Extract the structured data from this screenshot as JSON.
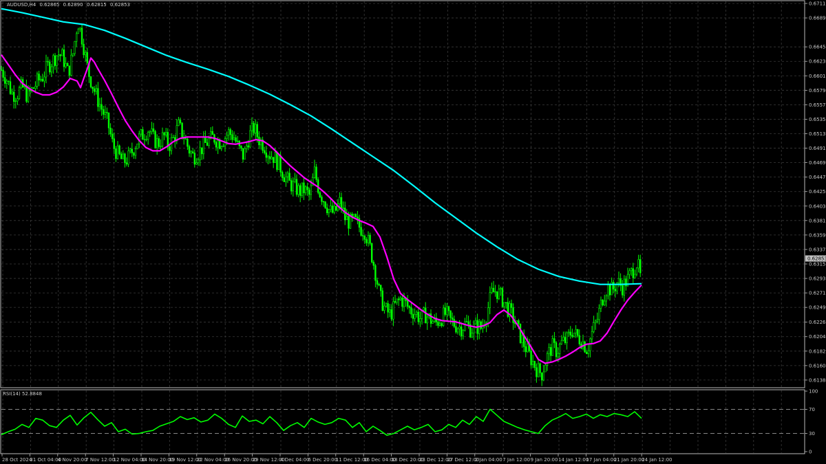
{
  "header": {
    "symbol_label": "AUDUSD,H4",
    "ohlc": [
      "0.62865",
      "0.62890",
      "0.62815",
      "0.62853"
    ]
  },
  "current_price_label": "0.62853",
  "rsi_label": "RSI(14) 52.8848",
  "colors": {
    "background": "#000000",
    "grid": "#3a3a3a",
    "bull_candle": "#00ff00",
    "bear_candle": "#00ff00",
    "ma_fast": "#ff00ff",
    "ma_slow": "#00ffff",
    "rsi_line": "#00ff00",
    "axis_text": "#c8c8c8",
    "price_tag_bg": "#c0c0c0"
  },
  "chart_data": [
    {
      "type": "line",
      "title": "AUDUSD,H4",
      "ylim": [
        0.6129,
        0.6711
      ],
      "yticks": [
        "0.67110",
        "0.66890",
        "0.66450",
        "0.66230",
        "0.66010",
        "0.65790",
        "0.65570",
        "0.65350",
        "0.65130",
        "0.64910",
        "0.64690",
        "0.64470",
        "0.64250",
        "0.64030",
        "0.63810",
        "0.63590",
        "0.63370",
        "0.63150",
        "0.62930",
        "0.62710",
        "0.62490",
        "0.62265",
        "0.62045",
        "0.61825",
        "0.61605",
        "0.61385"
      ],
      "xticks": [
        "28 Oct 2024",
        "31 Oct 04:00",
        "4 Nov 20:00",
        "7 Nov 12:00",
        "12 Nov 04:00",
        "14 Nov 20:00",
        "19 Nov 12:00",
        "22 Nov 04:00",
        "26 Nov 20:00",
        "29 Nov 12:00",
        "4 Dec 04:00",
        "6 Dec 20:00",
        "11 Dec 12:00",
        "16 Dec 04:00",
        "18 Dec 20:00",
        "23 Dec 12:00",
        "27 Dec 12:00",
        "2 Jan 04:00",
        "7 Jan 12:00",
        "9 Jan 20:00",
        "14 Jan 12:00",
        "17 Jan 04:00",
        "21 Jan 20:00",
        "24 Jan 12:00"
      ],
      "close_path": {
        "x": [
          0,
          8,
          15,
          22,
          30,
          38,
          45,
          52,
          60,
          67,
          75,
          82,
          89,
          97,
          104,
          111,
          118,
          126,
          133,
          140,
          148,
          155,
          162,
          170,
          177,
          184,
          192,
          199,
          206,
          214,
          221,
          228,
          236,
          243,
          250,
          257,
          265,
          272,
          279,
          287,
          294,
          301,
          308,
          316,
          323,
          330,
          338,
          345,
          352
        ],
        "y": [
          0.661,
          0.6595,
          0.6575,
          0.6572,
          0.6585,
          0.657,
          0.658,
          0.6592,
          0.66,
          0.6615,
          0.6625,
          0.6635,
          0.663,
          0.6605,
          0.6635,
          0.6685,
          0.6655,
          0.6608,
          0.6585,
          0.6565,
          0.6545,
          0.6528,
          0.6495,
          0.648,
          0.647,
          0.6475,
          0.649,
          0.6505,
          0.6512,
          0.652,
          0.6505,
          0.6498,
          0.651,
          0.6495,
          0.6505,
          0.6525,
          0.651,
          0.649,
          0.6478,
          0.6485,
          0.6495,
          0.6502,
          0.6508,
          0.65,
          0.6505,
          0.6515,
          0.6508,
          0.649,
          0.6478
        ]
      },
      "close_path_2": {
        "x": [
          360,
          367,
          374,
          382,
          389,
          396,
          404,
          411,
          418,
          426,
          433,
          440,
          448,
          455,
          462,
          470,
          477,
          484,
          492,
          499,
          506,
          514,
          521,
          528,
          536,
          543,
          550,
          558,
          565,
          572,
          580,
          587,
          594,
          602,
          609,
          616,
          624,
          631,
          638,
          646,
          653,
          660,
          668,
          675,
          682,
          690,
          697,
          704,
          712
        ],
        "y": [
          0.651,
          0.6522,
          0.6505,
          0.6495,
          0.6482,
          0.6478,
          0.6465,
          0.645,
          0.6438,
          0.6432,
          0.6425,
          0.6428,
          0.6418,
          0.6455,
          0.6425,
          0.641,
          0.6395,
          0.6392,
          0.641,
          0.6385,
          0.6378,
          0.638,
          0.637,
          0.6365,
          0.6338,
          0.6305,
          0.6265,
          0.6245,
          0.6238,
          0.6252,
          0.6262,
          0.6255,
          0.6245,
          0.624,
          0.6232,
          0.6238,
          0.623,
          0.6225,
          0.6232,
          0.624,
          0.6228,
          0.6222,
          0.6218,
          0.6225,
          0.6215,
          0.622,
          0.6218,
          0.6235,
          0.627
        ]
      },
      "close_path_3": {
        "x": [
          719,
          726,
          734,
          741,
          748,
          756,
          763,
          770,
          778,
          785,
          792,
          800,
          807,
          814,
          822,
          829,
          836,
          844,
          851,
          858,
          866,
          873,
          880,
          888,
          895,
          902,
          910,
          917,
          924,
          930
        ],
        "y": [
          0.6275,
          0.6265,
          0.625,
          0.6238,
          0.6222,
          0.62,
          0.6185,
          0.617,
          0.6155,
          0.6148,
          0.6172,
          0.619,
          0.6182,
          0.6195,
          0.62,
          0.6215,
          0.6205,
          0.6198,
          0.6185,
          0.621,
          0.6232,
          0.6262,
          0.628,
          0.6275,
          0.6288,
          0.628,
          0.6292,
          0.6305,
          0.6318,
          0.6285
        ]
      },
      "series": [
        {
          "name": "",
          "color": "#ff00ff",
          "x": [
            0,
            10,
            20,
            30,
            40,
            50,
            60,
            70,
            80,
            90,
            100,
            110,
            115,
            120,
            125,
            130,
            135,
            140,
            150,
            160,
            170,
            180,
            190,
            200,
            210,
            220,
            230,
            240,
            250,
            260,
            270,
            280,
            290,
            300,
            310,
            320,
            330,
            340,
            350,
            360,
            370,
            380,
            390,
            400,
            410,
            420,
            430,
            440,
            450,
            460,
            470,
            480,
            490,
            500,
            510,
            520,
            530,
            540,
            550,
            560,
            570,
            580,
            590,
            600,
            610,
            620,
            630,
            640,
            650,
            660,
            670,
            680,
            690,
            700,
            710,
            720,
            730,
            740,
            750,
            760,
            770,
            780,
            790,
            800,
            810,
            820,
            830,
            840,
            850,
            860,
            870,
            880,
            890,
            900,
            910,
            920,
            930
          ],
          "y": [
            0.6633,
            0.6618,
            0.6603,
            0.659,
            0.6582,
            0.6576,
            0.6572,
            0.6572,
            0.6576,
            0.6584,
            0.6597,
            0.6593,
            0.6583,
            0.6598,
            0.6612,
            0.6628,
            0.6622,
            0.6612,
            0.6594,
            0.6574,
            0.6553,
            0.6533,
            0.6517,
            0.6503,
            0.6492,
            0.6487,
            0.6487,
            0.6493,
            0.6501,
            0.6506,
            0.6508,
            0.6508,
            0.6508,
            0.6508,
            0.6506,
            0.6502,
            0.6498,
            0.6497,
            0.6499,
            0.6501,
            0.6504,
            0.6502,
            0.6495,
            0.6485,
            0.6474,
            0.6464,
            0.6455,
            0.6446,
            0.6439,
            0.6432,
            0.6423,
            0.6413,
            0.6402,
            0.6393,
            0.6386,
            0.6381,
            0.6377,
            0.6372,
            0.6356,
            0.6326,
            0.6292,
            0.627,
            0.6261,
            0.6253,
            0.6245,
            0.6238,
            0.6232,
            0.6229,
            0.6228,
            0.6227,
            0.6224,
            0.6221,
            0.6219,
            0.6221,
            0.6226,
            0.6238,
            0.6245,
            0.6237,
            0.6222,
            0.6205,
            0.6188,
            0.617,
            0.6164,
            0.6166,
            0.617,
            0.6175,
            0.6181,
            0.6188,
            0.6193,
            0.6194,
            0.6198,
            0.621,
            0.6228,
            0.6245,
            0.626,
            0.6272,
            0.6283
          ]
        },
        {
          "name": "",
          "color": "#00ffff",
          "x": [
            0,
            30,
            60,
            90,
            120,
            150,
            180,
            210,
            240,
            270,
            300,
            330,
            360,
            390,
            420,
            450,
            480,
            510,
            540,
            570,
            600,
            630,
            660,
            690,
            720,
            750,
            780,
            810,
            840,
            870,
            900,
            930
          ],
          "y": [
            0.6703,
            0.6697,
            0.669,
            0.6683,
            0.6679,
            0.667,
            0.6658,
            0.6645,
            0.6632,
            0.6621,
            0.6611,
            0.66,
            0.6587,
            0.6573,
            0.6557,
            0.654,
            0.652,
            0.6499,
            0.6478,
            0.6457,
            0.6433,
            0.6408,
            0.6385,
            0.6362,
            0.6341,
            0.6322,
            0.6307,
            0.6296,
            0.6289,
            0.6284,
            0.6284,
            0.6285
          ]
        }
      ]
    },
    {
      "type": "line",
      "title": "RSI(14) 52.8848",
      "ylim": [
        0,
        100
      ],
      "yticks": [
        "100",
        "70",
        "30",
        "0"
      ],
      "levels": [
        70,
        30
      ],
      "series": [
        {
          "name": "RSI(14)",
          "color": "#00ff00",
          "x": [
            0,
            10,
            20,
            30,
            40,
            50,
            60,
            70,
            80,
            90,
            100,
            110,
            120,
            130,
            140,
            150,
            160,
            170,
            180,
            190,
            200,
            210,
            220,
            230,
            240,
            250,
            260,
            270,
            280,
            290,
            300,
            310,
            320,
            330,
            340,
            350,
            360,
            370,
            380,
            390,
            400,
            410,
            420,
            430,
            440,
            450,
            460,
            470,
            480,
            490,
            500,
            510,
            520,
            530,
            540,
            550,
            560,
            570,
            580,
            590,
            600,
            610,
            620,
            630,
            640,
            650,
            660,
            670,
            680,
            690,
            700,
            710,
            720,
            730,
            740,
            750,
            760,
            770,
            780,
            790,
            800,
            810,
            820,
            830,
            840,
            850,
            860,
            870,
            880,
            890,
            900,
            910,
            920,
            930
          ],
          "y": [
            28,
            33,
            37,
            45,
            40,
            55,
            52,
            43,
            40,
            52,
            60,
            44,
            56,
            65,
            53,
            42,
            48,
            33,
            37,
            29,
            30,
            33,
            35,
            42,
            46,
            50,
            58,
            53,
            56,
            49,
            52,
            62,
            55,
            45,
            40,
            59,
            50,
            52,
            46,
            58,
            48,
            35,
            43,
            48,
            40,
            55,
            49,
            45,
            48,
            55,
            52,
            40,
            48,
            33,
            42,
            35,
            27,
            30,
            36,
            42,
            36,
            40,
            45,
            33,
            36,
            45,
            40,
            52,
            45,
            58,
            50,
            70,
            60,
            50,
            45,
            40,
            36,
            33,
            30,
            43,
            52,
            57,
            63,
            55,
            58,
            62,
            55,
            61,
            58,
            63,
            61,
            58,
            66,
            55
          ]
        }
      ]
    }
  ]
}
